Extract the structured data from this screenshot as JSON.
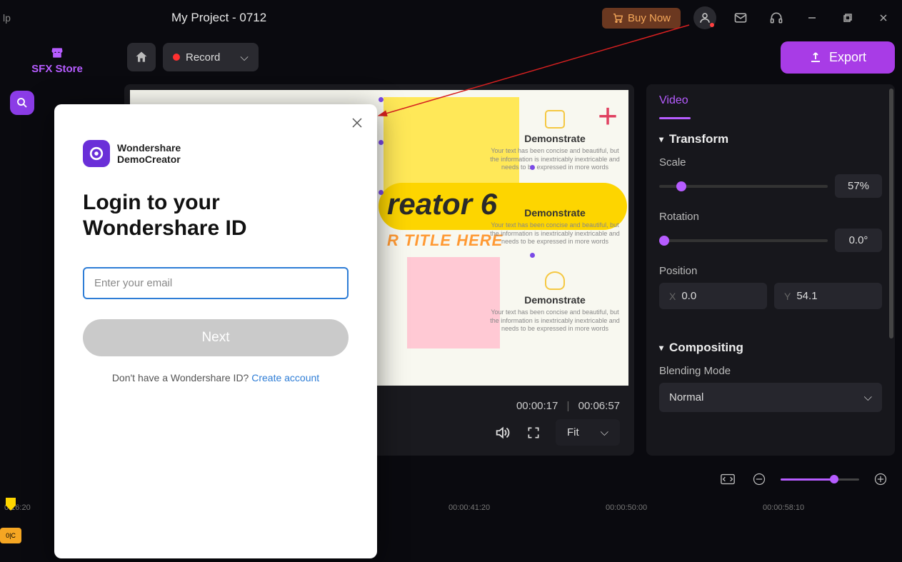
{
  "titlebar": {
    "menu_fragment": "lp",
    "project_title": "My Project - 0712",
    "buy_now": "Buy Now"
  },
  "toolbar": {
    "record_label": "Record",
    "export_label": "Export"
  },
  "sidebar": {
    "sfx_store": "SFX Store"
  },
  "preview": {
    "creator_text": "reator 6",
    "title_here": "R TITLE HERE",
    "demo_heading": "Demonstrate",
    "demo_body": "Your text has been concise and beautiful, but the information is inextricably inextricable and needs to be expressed in more words",
    "current_time": "00:00:17",
    "total_time": "00:06:57",
    "fit_label": "Fit",
    "plus": "+"
  },
  "props": {
    "tab": "Video",
    "transform_label": "Transform",
    "scale_label": "Scale",
    "scale_value": "57%",
    "rotation_label": "Rotation",
    "rotation_value": "0.0°",
    "position_label": "Position",
    "pos_x": "0.0",
    "pos_y": "54.1",
    "compositing_label": "Compositing",
    "blending_label": "Blending Mode",
    "blending_value": "Normal"
  },
  "timeline": {
    "ticks": [
      "0:16:20",
      "00:00:41:20",
      "00:00:50:00",
      "00:00:58:10"
    ],
    "clip_label": "0|C"
  },
  "modal": {
    "brand_line1": "Wondershare",
    "brand_line2": "DemoCreator",
    "heading": "Login to your Wondershare ID",
    "email_placeholder": "Enter your email",
    "next": "Next",
    "no_id": "Don't have a Wondershare ID? ",
    "create": "Create account"
  }
}
